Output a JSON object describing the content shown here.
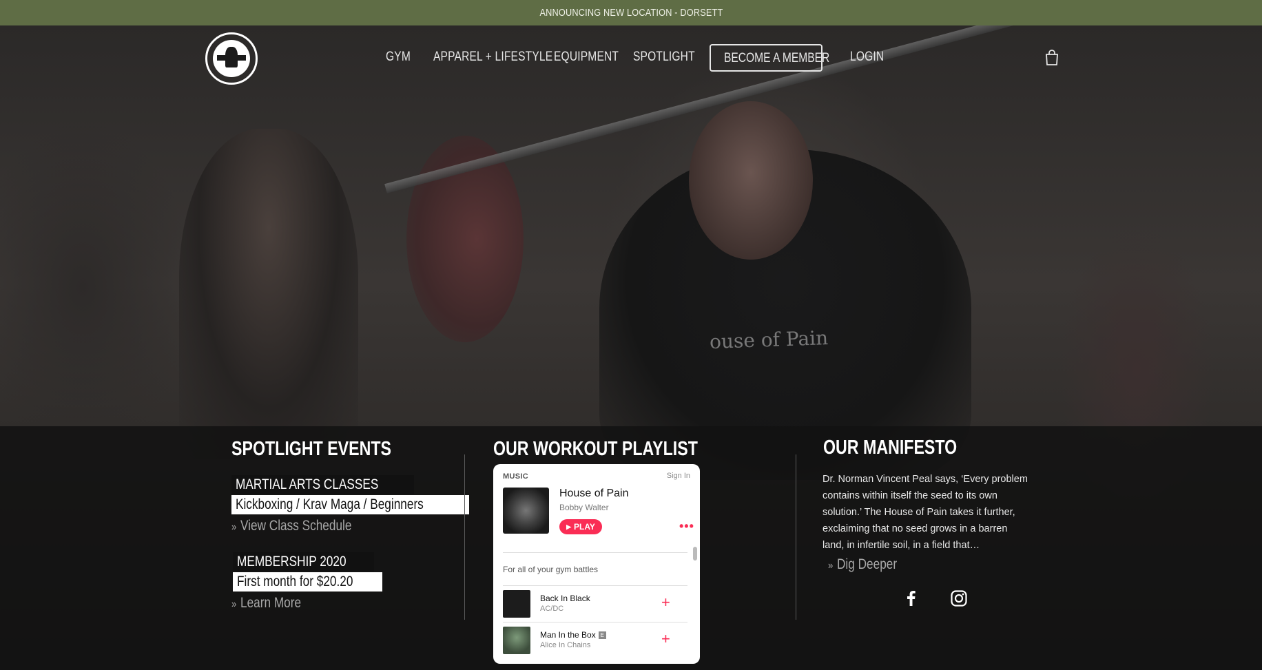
{
  "announcement": "ANNOUNCING NEW LOCATION - DORSETT",
  "nav": {
    "items": [
      "GYM",
      "APPAREL + LIFESTYLE",
      "EQUIPMENT",
      "SPOTLIGHT",
      "LOGIN"
    ],
    "cta": "BECOME A MEMBER",
    "cart_icon": "shopping-bag-icon"
  },
  "hero": {
    "shirt_text": "ouse of Pain"
  },
  "spotlight": {
    "title": "SPOTLIGHT EVENTS",
    "events": [
      {
        "category": "MARTIAL ARTS CLASSES",
        "detail": "Kickboxing / Krav Maga / Beginners",
        "link": "View Class Schedule"
      },
      {
        "category": "MEMBERSHIP 2020",
        "detail": "First month for $20.20",
        "link": "Learn More"
      }
    ]
  },
  "playlist": {
    "title": "OUR WORKOUT PLAYLIST",
    "widget": {
      "brand": "MUSIC",
      "signin": "Sign In",
      "playlist_name": "House of Pain",
      "curator": "Bobby Walter",
      "play_label": "PLAY",
      "more_label": "•••",
      "description": "For all of your gym battles",
      "tracks": [
        {
          "name": "Back In Black",
          "artist": "AC/DC",
          "explicit": false
        },
        {
          "name": "Man In the Box",
          "artist": "Alice In Chains",
          "explicit": true
        }
      ],
      "explicit_label": "E",
      "add_label": "+"
    }
  },
  "manifesto": {
    "title": "OUR MANIFESTO",
    "text": "Dr. Norman Vincent Peal says, ‘Every problem contains within itself the seed to its own solution.’ The House of Pain takes it further, exclaiming that no seed grows in a barren land, in infertile soil, in a field that…",
    "link": "Dig Deeper",
    "social": [
      "facebook-icon",
      "instagram-icon"
    ]
  },
  "colors": {
    "announce_bg": "#5f6d45",
    "accent": "#fa2d55"
  }
}
